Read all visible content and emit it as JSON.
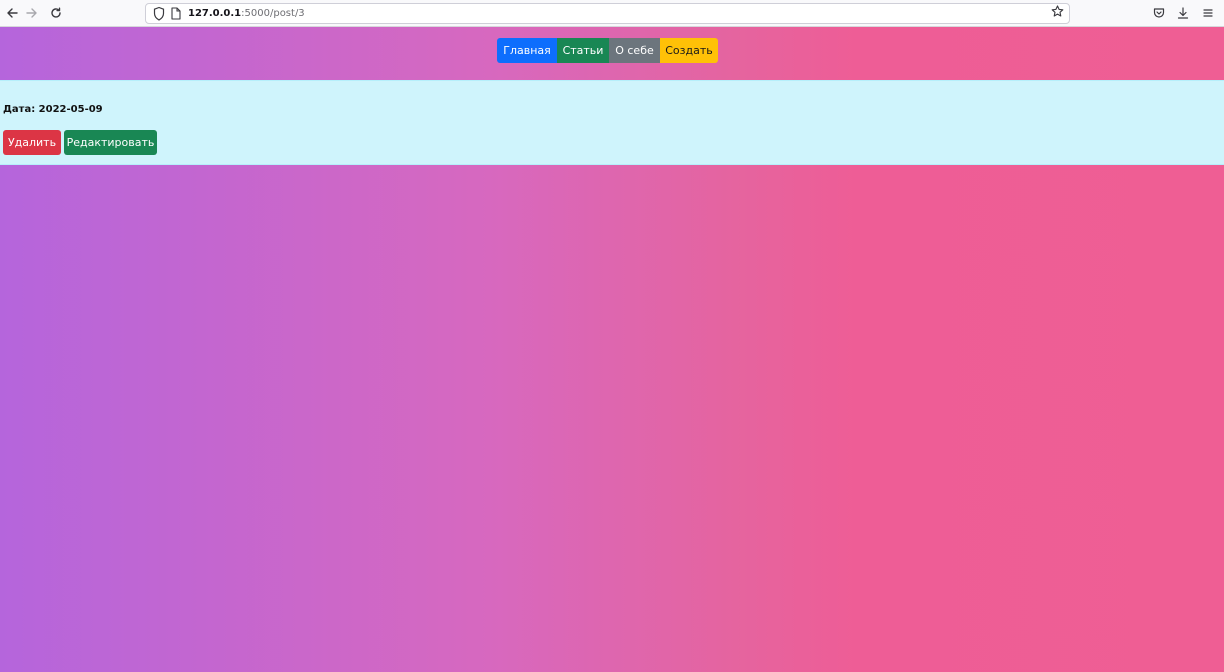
{
  "browser": {
    "url_host": "127.0.0.1",
    "url_rest": ":5000/post/3",
    "icons": {
      "back": "arrow-left-icon",
      "forward": "arrow-right-icon",
      "reload": "reload-icon",
      "shield": "shield-icon",
      "page": "page-icon",
      "star": "star-icon",
      "pocket": "pocket-icon",
      "download": "download-icon",
      "menu": "hamburger-menu-icon"
    }
  },
  "nav": {
    "items": [
      {
        "label": "Главная",
        "color": "#0d6efd"
      },
      {
        "label": "Статьи",
        "color": "#198754"
      },
      {
        "label": "О себе",
        "color": "#6c757d"
      },
      {
        "label": "Создать",
        "color": "#ffc107"
      }
    ]
  },
  "post": {
    "date_text": "Дата: 2022-05-09",
    "delete_label": "Удалить",
    "edit_label": "Редактировать",
    "delete_color": "#dc3545",
    "edit_color": "#198754",
    "card_color": "#cff4fc"
  },
  "page": {
    "gradient_start": "#b565dc",
    "gradient_end": "#ef5e94"
  }
}
